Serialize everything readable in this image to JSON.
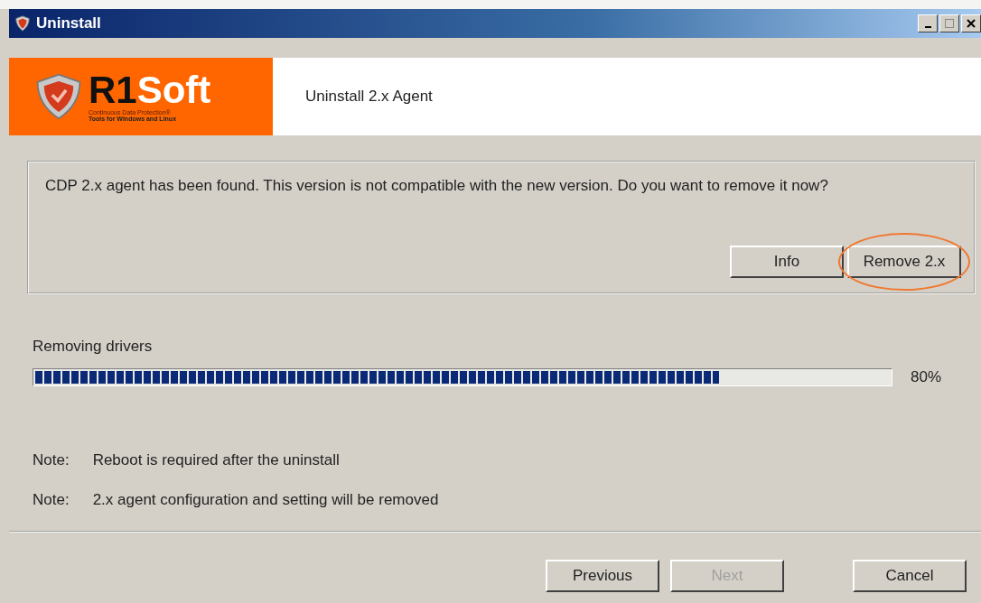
{
  "window": {
    "title": "Uninstall"
  },
  "banner": {
    "brand_prefix": "R1",
    "brand_suffix": "Soft",
    "tagline_1": "Continuous Data Protection®",
    "tagline_2": "Tools for Windows and Linux",
    "heading": "Uninstall 2.x Agent"
  },
  "message": {
    "text": "CDP 2.x agent has been found. This version is not compatible with the new version. Do you want to remove it now?",
    "buttons": [
      {
        "label": "Info",
        "highlighted": false
      },
      {
        "label": "Remove 2.x",
        "highlighted": true
      }
    ]
  },
  "progress": {
    "label": "Removing drivers",
    "level": 0.8,
    "reading": "80%"
  },
  "notes": [
    {
      "label": "Note:",
      "text": "Reboot is required after the uninstall"
    },
    {
      "label": "Note:",
      "text": "2.x agent configuration and setting will be removed"
    }
  ],
  "footer_buttons": [
    {
      "label": "Previous",
      "disabled": false
    },
    {
      "label": "Next",
      "disabled": true
    },
    {
      "label": "Cancel",
      "disabled": false
    }
  ]
}
